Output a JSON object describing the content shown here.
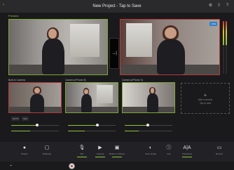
{
  "header": {
    "back_label": "‹",
    "subtitle": "",
    "title": "New Project - Tap to Save",
    "icons": [
      "gear-icon",
      "share-icon",
      "help-icon"
    ]
  },
  "preview": {
    "label": "Preview"
  },
  "program": {
    "live_badge": "LIVE"
  },
  "cut": {
    "label": "→|"
  },
  "sources": [
    {
      "label": "Built-in Camera",
      "slider": 0.55
    },
    {
      "label": "Camera (iPhone 8)",
      "slider": 0.62
    },
    {
      "label": "Camera (iPhone X)",
      "slider": 0.48
    }
  ],
  "add_source": {
    "plus": "+",
    "text": "Add a source\nTap to add"
  },
  "source_controls": [
    "AUTO",
    "MIC",
    "",
    ""
  ],
  "toolbar": {
    "tools": [
      {
        "icon": "●",
        "label": "Stream",
        "name": "stream-icon"
      },
      {
        "icon": "▢",
        "label": "Multiview",
        "name": "multiview-icon"
      },
      {
        "icon": "🎙",
        "label": "Mic",
        "name": "mic-icon"
      },
      {
        "icon": "▶",
        "label": "Camera",
        "name": "video-icon"
      },
      {
        "icon": "▣",
        "label": "Picture in Picture",
        "name": "pip-icon"
      },
      {
        "icon": "◐",
        "label": "Color Grade",
        "name": "color-icon"
      },
      {
        "icon": "ⓘ",
        "label": "Info",
        "name": "info-icon"
      },
      {
        "icon": "A|A",
        "label": "Transitions",
        "name": "transition-icon"
      },
      {
        "icon": "▭",
        "label": "Record",
        "name": "record-icon"
      }
    ]
  },
  "bottom": {
    "left": "⏷",
    "mid": ""
  },
  "colors": {
    "accent": "#8fbf3f",
    "program_border": "#b33a3a",
    "live": "#2f7ec9"
  }
}
